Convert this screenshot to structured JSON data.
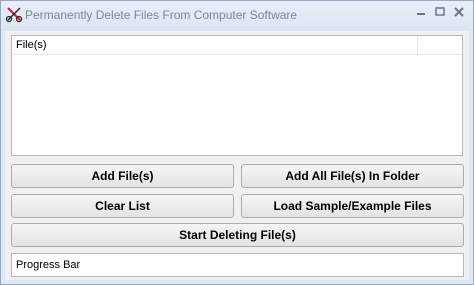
{
  "window": {
    "title": "Permanently Delete Files From Computer Software",
    "icon": "scissors-icon"
  },
  "file_list": {
    "columns": [
      "File(s)"
    ],
    "rows": []
  },
  "buttons": {
    "add_files": "Add File(s)",
    "add_folder": "Add All File(s) In Folder",
    "clear_list": "Clear List",
    "load_sample": "Load Sample/Example Files",
    "start_deleting": "Start Deleting File(s)"
  },
  "progress": {
    "label": "Progress Bar",
    "value": 0
  },
  "colors": {
    "accent_red": "#c1272d"
  }
}
